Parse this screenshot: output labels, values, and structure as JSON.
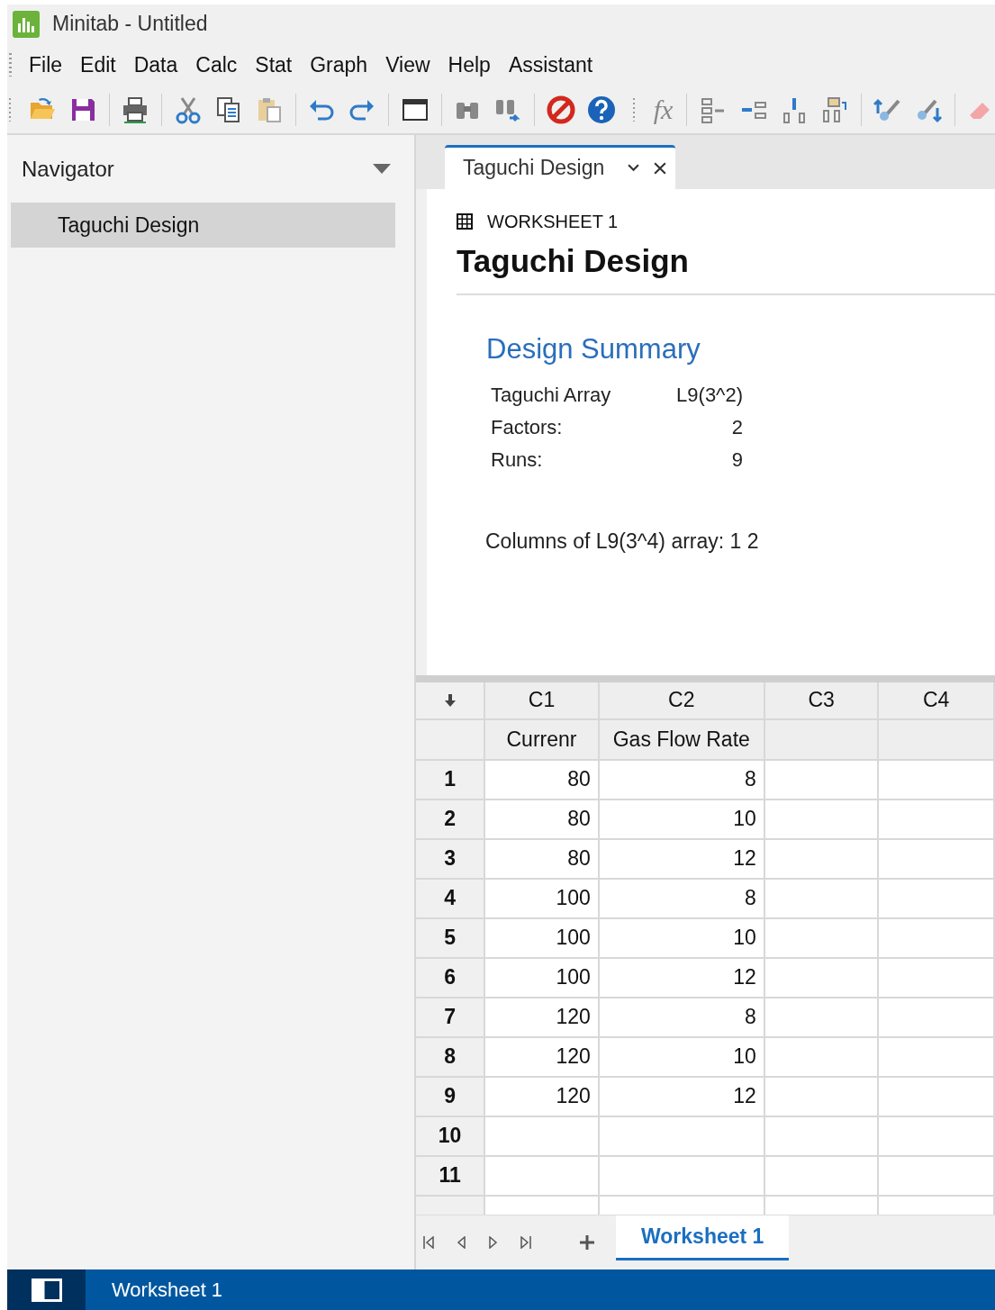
{
  "window": {
    "title": "Minitab - Untitled"
  },
  "menu": [
    "File",
    "Edit",
    "Data",
    "Calc",
    "Stat",
    "Graph",
    "View",
    "Help",
    "Assistant"
  ],
  "toolbar": {
    "formula_label": "fx"
  },
  "navigator": {
    "title": "Navigator",
    "items": [
      {
        "label": "Taguchi Design",
        "selected": true
      }
    ]
  },
  "output_tabs": [
    {
      "label": "Taguchi Design",
      "selected": true
    }
  ],
  "output": {
    "worksheet_label": "WORKSHEET 1",
    "title": "Taguchi Design",
    "section_title": "Design Summary",
    "summary": [
      {
        "label": "Taguchi Array",
        "value": "L9(3^2)"
      },
      {
        "label": "Factors:",
        "value": "2"
      },
      {
        "label": "Runs:",
        "value": "9"
      }
    ],
    "note": "Columns of L9(3^4) array: 1 2"
  },
  "worksheet": {
    "columns": [
      {
        "id": "C1",
        "name": "Currenr"
      },
      {
        "id": "C2",
        "name": "Gas Flow Rate"
      },
      {
        "id": "C3"
      },
      {
        "id": "C4"
      }
    ],
    "rows": [
      {
        "number": "1",
        "cells": [
          "80",
          "8"
        ]
      },
      {
        "number": "2",
        "cells": [
          "80",
          "10"
        ]
      },
      {
        "number": "3",
        "cells": [
          "80",
          "12"
        ]
      },
      {
        "number": "4",
        "cells": [
          "100",
          "8"
        ]
      },
      {
        "number": "5",
        "cells": [
          "100",
          "10"
        ]
      },
      {
        "number": "6",
        "cells": [
          "100",
          "12"
        ]
      },
      {
        "number": "7",
        "cells": [
          "120",
          "8"
        ]
      },
      {
        "number": "8",
        "cells": [
          "120",
          "10"
        ]
      },
      {
        "number": "9",
        "cells": [
          "120",
          "12"
        ]
      },
      {
        "number": "10",
        "cells": []
      },
      {
        "number": "11",
        "cells": []
      }
    ]
  },
  "sheet_tabs": [
    {
      "label": "Worksheet 1",
      "selected": true
    }
  ],
  "status_bar": {
    "text": "Worksheet 1"
  }
}
